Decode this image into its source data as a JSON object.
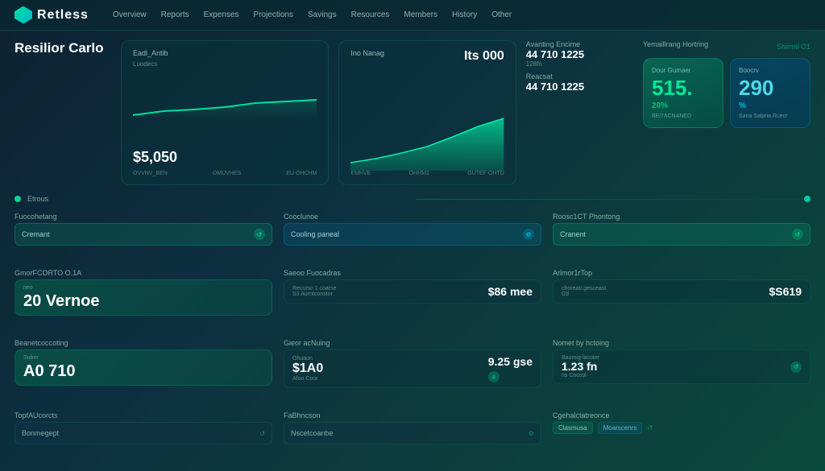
{
  "app": {
    "logo_text": "Retless",
    "logo_icon": "shield"
  },
  "navbar": {
    "links": [
      "Overview",
      "Reports",
      "Expenses",
      "Projections",
      "Savings",
      "Resources",
      "Members",
      "History",
      "Other"
    ]
  },
  "page": {
    "title": "Resilior Carlo"
  },
  "top_section": {
    "left_chart": {
      "label": "Eadl_Antib",
      "sublabel": "Luodecs",
      "value": "$5,050",
      "x_labels": [
        "OVVNV_BEN",
        "OMUVHES",
        "EU OHCHM"
      ],
      "line_points": "0,55 40,50 80,48 120,45 160,40 200,38 240,36"
    },
    "area_chart": {
      "title": "Ino Nanag",
      "subtitle": "Its 000",
      "value_label": "Avanting Encime",
      "value": "44 710 1225",
      "sub": "128fn",
      "x_labels": [
        "EMHVE",
        "OHHM1"
      ],
      "extra_label": "GUTEF OHTD"
    },
    "mid_stats": {
      "label1": "Avanting Encime",
      "value1": "44 710 1225",
      "sub1": "128fn",
      "label2": "Reacsat",
      "value2": "44 710 1225"
    },
    "right_area": {
      "header": "Yemaillrang Hortring",
      "status": "Shirmil O1",
      "card1": {
        "label": "Dour Gumaer",
        "percent": "515.",
        "pct_label": "20%",
        "sub": "BEl7ACNANED"
      },
      "card2": {
        "label": "Boocrv",
        "percent": "290",
        "pct_label": "%",
        "sub": "Sana Salpna Rcecr"
      }
    }
  },
  "divider": {
    "label": "Etrous"
  },
  "bottom": {
    "col1": {
      "section1_title": "Fuocohetang",
      "input1_text": "Cremant",
      "input1_icon": "↺",
      "section2_title": "GmorFCORTO O.1A",
      "card2_sub": "neo",
      "card2_value": "20 Vernoe",
      "card2_icon": "↺",
      "section3_title": "Beanetcoccoting",
      "card3_sub": "Suber",
      "card3_value": "A0 710",
      "card3_icon": "↺",
      "section4_title": "TopfAUcorcts",
      "select4_text": "Bonmegept",
      "select4_icon": "↺"
    },
    "col2": {
      "section1_title": "Cooclunoe",
      "input1_text": "Cooling paneal",
      "input1_icon": "⚙",
      "section2_title": "Saeoo Fuocadras",
      "card2_label1": "Recursc 1 coarse",
      "card2_label2": "S3 Aurntconstor",
      "card2_value": "$86 mee",
      "section3_title": "Gieor acNuing",
      "card3_label1": "Ohuaon",
      "card3_value1": "$1A0",
      "card3_sub1": "Afoo Coor",
      "card3_value2": "9.25 gse",
      "card3_icon": "≡",
      "section4_title": "FaBhncson",
      "select4_text": "Nscetcoanbe",
      "select4_icon": "⚙"
    },
    "col3": {
      "section1_title": "Roosc1CT Phontong",
      "input1_text": "Cranent",
      "input1_icon": "↺",
      "section2_title": "Arlmor1rTop",
      "card2_label1": "choreatr.gesceast",
      "card2_label2": "Gtl",
      "card2_value": "$S619",
      "section3_title": "Nomet by hctoing",
      "card3_label1": "Baomig-lacoter",
      "card3_value": "1.23 fn",
      "card3_sub": "ns Coccol",
      "card3_icon": "↺",
      "section4_title": "Cgehalctatreonce",
      "btn1": "Clasmusa",
      "btn2": "Moarscenrs",
      "select4_icon": "↺"
    }
  }
}
